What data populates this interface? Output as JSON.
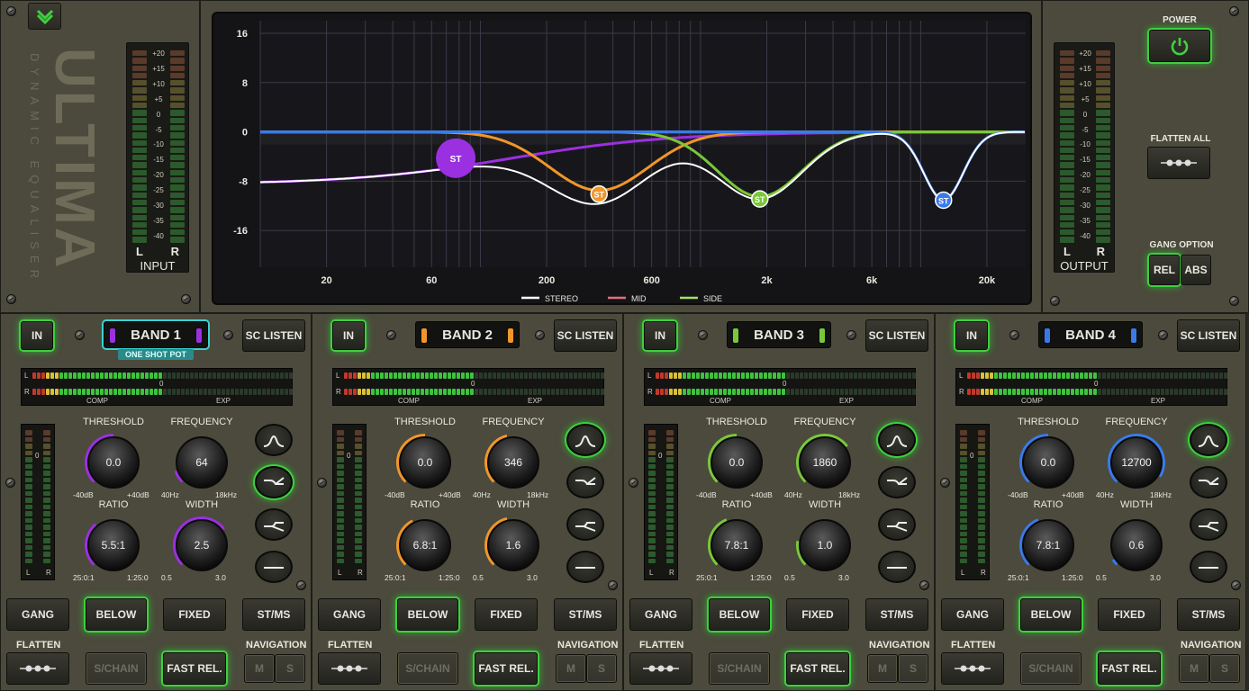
{
  "brand": {
    "name": "ULTIMA",
    "subtitle": "DYNAMIC EQUALISER"
  },
  "input_meter": {
    "title": "INPUT",
    "left": "L",
    "right": "R",
    "scale": [
      "+20",
      "+15",
      "+10",
      "+5",
      "0",
      "-5",
      "-10",
      "-15",
      "-20",
      "-25",
      "-30",
      "-35",
      "-40"
    ]
  },
  "output_meter": {
    "title": "OUTPUT",
    "left": "L",
    "right": "R",
    "scale": [
      "+20",
      "+15",
      "+10",
      "+5",
      "0",
      "-5",
      "-10",
      "-15",
      "-20",
      "-25",
      "-30",
      "-35",
      "-40"
    ]
  },
  "graph": {
    "y_ticks": [
      "16",
      "8",
      "0",
      "-8",
      "-16"
    ],
    "x_ticks": [
      "20",
      "60",
      "200",
      "600",
      "2k",
      "6k",
      "20k"
    ],
    "legend": [
      "STEREO",
      "MID",
      "SIDE"
    ],
    "node_label": "ST",
    "colors": {
      "stereo": "#ffffff",
      "mid": "#e07080",
      "side": "#a8e060",
      "band1": "#9b30e0",
      "band2": "#f0962a",
      "band3": "#7ac83a",
      "band4": "#3a7ae8",
      "flat": "#8ac8e8"
    }
  },
  "right_panel": {
    "power_label": "POWER",
    "flatten_all_label": "FLATTEN ALL",
    "gang_option_label": "GANG OPTION",
    "rel_label": "REL",
    "abs_label": "ABS"
  },
  "common": {
    "in_label": "IN",
    "sc_listen_label": "SC LISTEN",
    "comp_label": "COMP",
    "exp_label": "EXP",
    "zero_label": "0",
    "l_label": "L",
    "r_label": "R",
    "threshold_label": "THRESHOLD",
    "frequency_label": "FREQUENCY",
    "ratio_label": "RATIO",
    "width_label": "WIDTH",
    "gang_label": "GANG",
    "below_label": "BELOW",
    "fixed_label": "FIXED",
    "stms_label": "ST/MS",
    "flatten_label": "FLATTEN",
    "schain_label": "S/CHAIN",
    "fastrel_label": "FAST REL.",
    "navigation_label": "NAVIGATION",
    "m_label": "M",
    "s_label": "S",
    "thr_min": "-40dB",
    "thr_max": "+40dB",
    "ratio_min": "25:0:1",
    "ratio_max": "1:25:0",
    "width_min": "0.5",
    "width_max": "3.0",
    "one_shot_pot": "ONE SHOT POT"
  },
  "bands": [
    {
      "name": "BAND 1",
      "color": "#9b30e0",
      "threshold": "0.0",
      "frequency": "64",
      "freq_min": "40Hz",
      "freq_max": "18kHz",
      "ratio": "5.5:1",
      "width": "2.5",
      "selected": true,
      "active_shape": "low-shelf"
    },
    {
      "name": "BAND 2",
      "color": "#f0962a",
      "threshold": "0.0",
      "frequency": "346",
      "freq_min": "40Hz",
      "freq_max": "18kHz",
      "ratio": "6.8:1",
      "width": "1.6",
      "selected": false,
      "active_shape": "bell"
    },
    {
      "name": "BAND 3",
      "color": "#7ac83a",
      "threshold": "0.0",
      "frequency": "1860",
      "freq_min": "40Hz",
      "freq_max": "18kHz",
      "ratio": "7.8:1",
      "width": "1.0",
      "selected": false,
      "active_shape": "bell"
    },
    {
      "name": "BAND 4",
      "color": "#3a7ae8",
      "threshold": "0.0",
      "frequency": "12700",
      "freq_min": "40Hz",
      "freq_max": "18kHz",
      "ratio": "7.8:1",
      "width": "0.6",
      "selected": false,
      "active_shape": "bell"
    }
  ]
}
